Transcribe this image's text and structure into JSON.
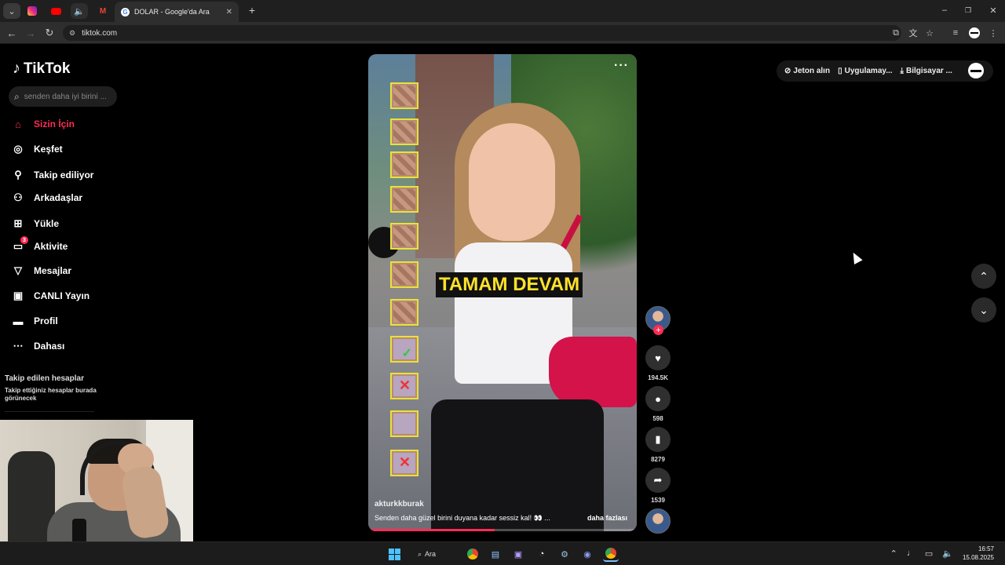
{
  "browser": {
    "tabs": [
      {
        "name": "expand",
        "icon": "chevron-down-icon"
      },
      {
        "name": "instagram",
        "icon": "instagram-icon"
      },
      {
        "name": "youtube",
        "icon": "youtube-icon"
      },
      {
        "name": "tiktok-audio",
        "icon": "speaker-icon"
      },
      {
        "name": "gmail",
        "icon": "gmail-icon"
      }
    ],
    "active_tab_title": "DOLAR - Google'da Ara",
    "url": "tiktok.com"
  },
  "sidebar": {
    "logo": "TikTok",
    "search_placeholder": "senden daha iyi birini ...",
    "nav": [
      {
        "label": "Sizin İçin",
        "icon": "home-icon",
        "active": true
      },
      {
        "label": "Keşfet",
        "icon": "compass-icon"
      },
      {
        "label": "Takip ediliyor",
        "icon": "follow-icon"
      },
      {
        "label": "Arkadaşlar",
        "icon": "friends-icon"
      },
      {
        "label": "Yükle",
        "icon": "upload-icon"
      },
      {
        "label": "Aktivite",
        "icon": "activity-icon",
        "badge": "3"
      },
      {
        "label": "Mesajlar",
        "icon": "send-icon"
      },
      {
        "label": "CANLI Yayın",
        "icon": "live-icon"
      },
      {
        "label": "Profil",
        "icon": "profile-icon"
      },
      {
        "label": "Dahası",
        "icon": "more-icon"
      }
    ],
    "followed_title": "Takip edilen hesaplar",
    "followed_desc": "Takip ettiğiniz hesaplar burada görünecek"
  },
  "video": {
    "overlay_text": "TAMAM DEVAM",
    "author": "akturkkburak",
    "description": "Senden daha güzel birini duyana kadar sessiz kal! 👀 ...",
    "more_link": "daha fazlası",
    "progress": 0.47
  },
  "actions": {
    "likes": "194.5K",
    "comments": "598",
    "saves": "8279",
    "shares": "1539"
  },
  "topbar": {
    "coins": "Jeton alın",
    "app": "Uygulamay...",
    "desktop": "Bilgisayar ..."
  },
  "taskbar": {
    "search_label": "Ara",
    "time": "16:57",
    "date": "15.08.2025"
  },
  "colors": {
    "accent": "#fe2c55",
    "caption_yellow": "#ffe22b"
  }
}
